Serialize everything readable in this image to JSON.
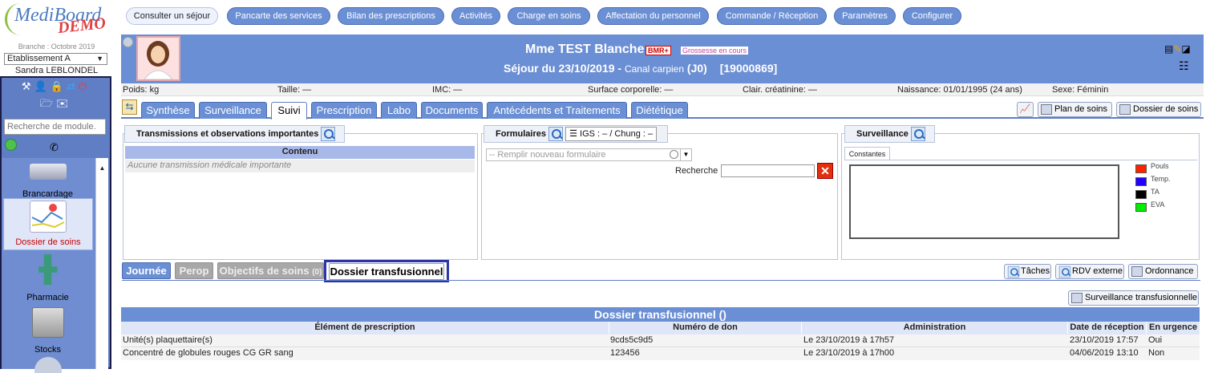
{
  "app": {
    "logo_text": "MediBoard",
    "logo_demo": "DEMO"
  },
  "sidebar": {
    "branche": "Branche : Octobre 2019",
    "etablissement": "Etablissement A",
    "user": "Sandra LEBLONDEL",
    "module_search_placeholder": "Recherche de module.",
    "modules": [
      {
        "label": "Brancardage",
        "icon": "stretcher-icon"
      },
      {
        "label": "Dossier de soins",
        "icon": "chart-icon"
      },
      {
        "label": "Pharmacie",
        "icon": "pharmacy-icon"
      },
      {
        "label": "Stocks",
        "icon": "box-icon"
      }
    ]
  },
  "topnav": [
    "Consulter un séjour",
    "Pancarte des services",
    "Bilan des prescriptions",
    "Activités",
    "Charge en soins",
    "Affectation du personnel",
    "Commande / Réception",
    "Paramètres",
    "Configurer"
  ],
  "patient": {
    "name": "Mme TEST Blanche",
    "badge_bmr": "BMR+",
    "badge_grossesse": "Grossesse en cours",
    "sejour_prefix": "Séjour du 23/10/2019 -",
    "sejour_detail": "Canal carpien",
    "sejour_day": "(J0)",
    "sejour_id": "[19000869]"
  },
  "infobar": {
    "poids": "Poids: kg",
    "taille": "Taille: —",
    "imc": "IMC: —",
    "surface": "Surface corporelle: —",
    "clair": "Clair. créatinine: —",
    "naissance": "Naissance: 01/01/1995 (24 ans)",
    "sexe": "Sexe: Féminin"
  },
  "tabs": [
    "Synthèse",
    "Surveillance",
    "Suivi",
    "Prescription",
    "Labo",
    "Documents",
    "Antécédents et Traitements",
    "Diététique"
  ],
  "tab_buttons": {
    "plan": "Plan de soins",
    "dossier": "Dossier de soins"
  },
  "transmissions": {
    "title": "Transmissions et observations importantes",
    "column": "Contenu",
    "empty": "Aucune transmission médicale importante"
  },
  "formulaires": {
    "title": "Formulaires",
    "igs": "IGS : – / Chung : –",
    "select_placeholder": "-- Remplir nouveau formulaire",
    "search_label": "Recherche"
  },
  "surveillance": {
    "title": "Surveillance",
    "tab": "Constantes",
    "legend": [
      {
        "label": "Pouls",
        "color": "#ff2200"
      },
      {
        "label": "Temp.",
        "color": "#2200ff"
      },
      {
        "label": "TA",
        "color": "#000000"
      },
      {
        "label": "EVA",
        "color": "#00ee00"
      }
    ]
  },
  "subtabs": {
    "journee": "Journée",
    "perop": "Perop",
    "objectifs": "Objectifs de soins",
    "objectifs_count": "(0)",
    "transfusion": "Dossier transfusionnel"
  },
  "sub_buttons": {
    "taches": "Tâches",
    "rdv": "RDV externe",
    "ordonnance": "Ordonnance",
    "surv_transf": "Surveillance transfusionnelle"
  },
  "table": {
    "title": "Dossier transfusionnel ()",
    "headers": [
      "Élément de prescription",
      "Numéro de don",
      "Administration",
      "Date de réception",
      "En urgence"
    ],
    "rows": [
      [
        "Unité(s) plaquettaire(s)",
        "9cds5c9d5",
        "Le 23/10/2019 à 17h57",
        "23/10/2019 17:57",
        "Oui"
      ],
      [
        "Concentré de globules rouges CG GR sang",
        "123456",
        "Le 23/10/2019 à 17h00",
        "04/06/2019 13:10",
        "Non"
      ]
    ]
  }
}
